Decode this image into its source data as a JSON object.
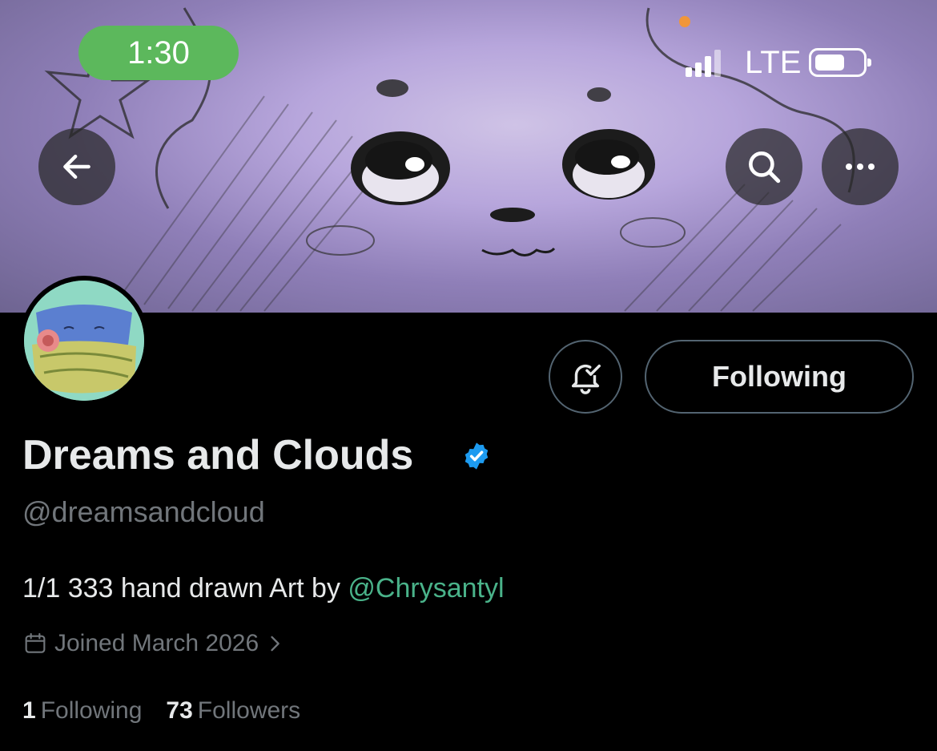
{
  "status_bar": {
    "time": "1:30",
    "network": "LTE",
    "signal_icon": "cellular-signal-icon",
    "battery_icon": "battery-icon"
  },
  "header": {
    "back_icon": "arrow-left-icon",
    "search_icon": "search-icon",
    "more_icon": "more-horizontal-icon"
  },
  "profile": {
    "display_name": "Dreams and Clouds",
    "handle": "@dreamsandcloud",
    "bio_text": "1/1 333 hand drawn Art by ",
    "bio_mention": "@Chrysantyl",
    "joined": "Joined March 2026",
    "following_count": "1",
    "following_label": "Following",
    "followers_count": "73",
    "followers_label": "Followers"
  },
  "actions": {
    "follow_button_label": "Following",
    "notifications_icon": "bell-check-icon"
  },
  "colors": {
    "accent_green": "#4ab38a",
    "time_pill": "#5cb85c",
    "verified_blue": "#1d9bf0",
    "muted_text": "#71767b"
  }
}
